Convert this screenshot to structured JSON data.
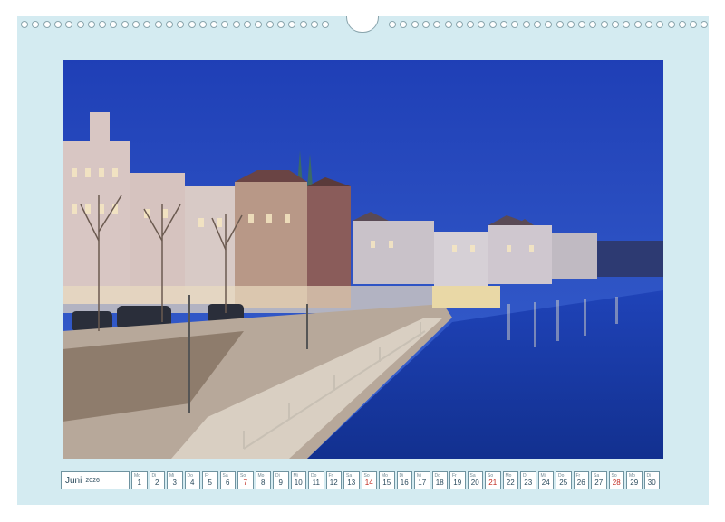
{
  "calendar": {
    "month": "Juni",
    "year": "2026",
    "days": [
      {
        "wd": "Mo",
        "d": "1"
      },
      {
        "wd": "Di",
        "d": "2"
      },
      {
        "wd": "Mi",
        "d": "3"
      },
      {
        "wd": "Do",
        "d": "4"
      },
      {
        "wd": "Fr",
        "d": "5"
      },
      {
        "wd": "Sa",
        "d": "6"
      },
      {
        "wd": "So",
        "d": "7"
      },
      {
        "wd": "Mo",
        "d": "8"
      },
      {
        "wd": "Di",
        "d": "9"
      },
      {
        "wd": "Mi",
        "d": "10"
      },
      {
        "wd": "Do",
        "d": "11"
      },
      {
        "wd": "Fr",
        "d": "12"
      },
      {
        "wd": "Sa",
        "d": "13"
      },
      {
        "wd": "So",
        "d": "14"
      },
      {
        "wd": "Mo",
        "d": "15"
      },
      {
        "wd": "Di",
        "d": "16"
      },
      {
        "wd": "Mi",
        "d": "17"
      },
      {
        "wd": "Do",
        "d": "18"
      },
      {
        "wd": "Fr",
        "d": "19"
      },
      {
        "wd": "Sa",
        "d": "20"
      },
      {
        "wd": "So",
        "d": "21"
      },
      {
        "wd": "Mo",
        "d": "22"
      },
      {
        "wd": "Di",
        "d": "23"
      },
      {
        "wd": "Mi",
        "d": "24"
      },
      {
        "wd": "Do",
        "d": "25"
      },
      {
        "wd": "Fr",
        "d": "26"
      },
      {
        "wd": "Sa",
        "d": "27"
      },
      {
        "wd": "So",
        "d": "28"
      },
      {
        "wd": "Mo",
        "d": "29"
      },
      {
        "wd": "Di",
        "d": "30"
      }
    ],
    "sunday_color": "#c0281e"
  },
  "colors": {
    "page_background": "#d4ebf1",
    "sky": "#2a4fc0",
    "water": "#1d3ea8"
  },
  "photo": {
    "subject": "evening-harbour-promenade"
  }
}
